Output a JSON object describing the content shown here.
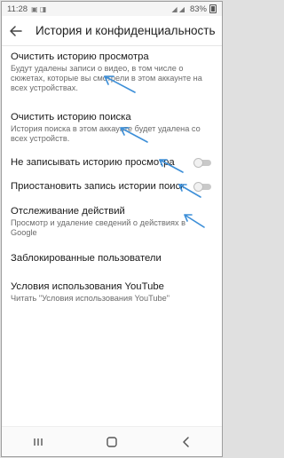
{
  "status_bar": {
    "time": "11:28",
    "extra": "▣ ◨",
    "signal": "◢ ◢",
    "battery_text": "83%"
  },
  "app_bar": {
    "back_icon": "arrow-left-icon",
    "title": "История и конфиденциальность"
  },
  "items": [
    {
      "title": "Очистить историю просмотра",
      "subtitle": "Будут удалены записи о видео, в том числе о сюжетах, которые вы смотрели в этом аккаунте на всех устройствах."
    },
    {
      "title": "Очистить историю поиска",
      "subtitle": "История поиска в этом аккаунте будет удалена со всех устройств."
    },
    {
      "title": "Не записывать историю просмотра",
      "toggle_on": false
    },
    {
      "title": "Приостановить запись истории поиска",
      "toggle_on": false
    },
    {
      "title": "Отслеживание действий",
      "subtitle": "Просмотр и удаление сведений о действиях в Google"
    },
    {
      "title": "Заблокированные пользователи"
    },
    {
      "title": "Условия использования YouTube",
      "subtitle": "Читать \"Условия использования YouTube\""
    }
  ],
  "annotation_color": "#3d8fd8",
  "nav_bar": {
    "recents_icon": "recents-icon",
    "home_icon": "home-icon",
    "back_icon": "back-chevron-icon"
  }
}
